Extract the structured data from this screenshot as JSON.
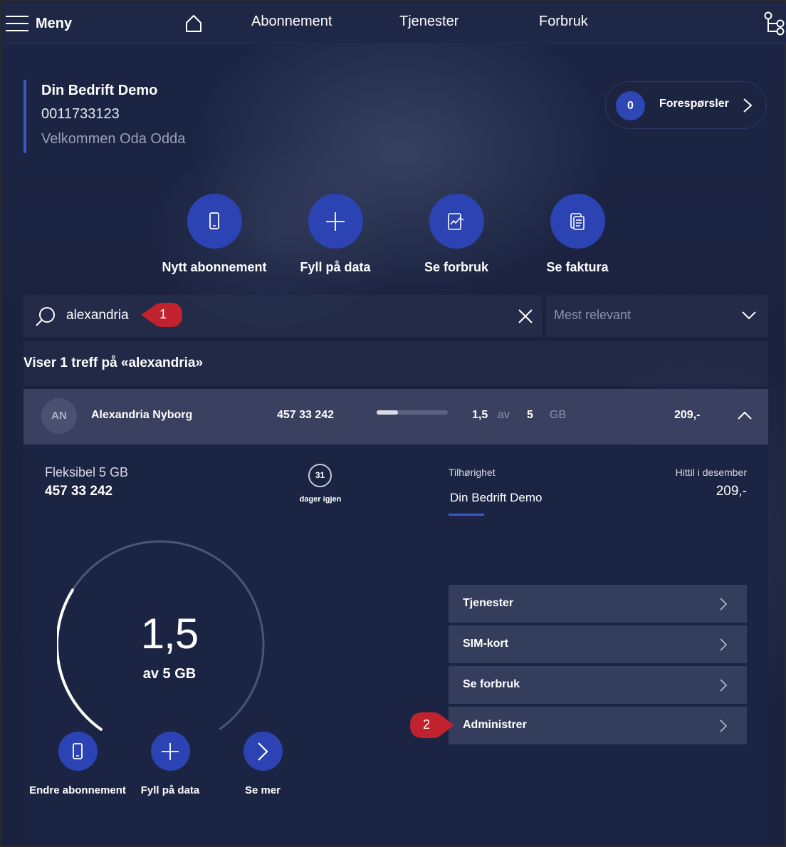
{
  "nav": {
    "menu_label": "Meny",
    "links": [
      "Abonnement",
      "Tjenester",
      "Forbruk"
    ]
  },
  "company": {
    "name": "Din Bedrift Demo",
    "number": "0011733123",
    "welcome": "Velkommen Oda Odda"
  },
  "requests": {
    "count": "0",
    "label": "Forespørsler"
  },
  "quick_actions": [
    {
      "label": "Nytt abonnement",
      "icon": "phone-icon"
    },
    {
      "label": "Fyll på data",
      "icon": "plus-icon"
    },
    {
      "label": "Se forbruk",
      "icon": "usage-chart-icon"
    },
    {
      "label": "Se faktura",
      "icon": "invoice-icon"
    }
  ],
  "search": {
    "value": "alexandria",
    "marker": "1"
  },
  "sort": {
    "selected": "Mest relevant"
  },
  "results": {
    "text": "Viser 1 treff på «alexandria»"
  },
  "subscription": {
    "initials": "AN",
    "name": "Alexandria Nyborg",
    "phone": "457 33 242",
    "used": "1,5",
    "of_label": "av",
    "total": "5",
    "unit": "GB",
    "usage_fraction": 0.3,
    "price": "209,-"
  },
  "detail": {
    "plan": "Fleksibel 5 GB",
    "phone": "457 33 242",
    "days": "31",
    "days_label": "dager igjen",
    "belonging_label": "Tilhørighet",
    "belonging_value": "Din Bedrift Demo",
    "so_far_label": "Hittil i desember",
    "so_far_value": "209,-",
    "gauge_value": "1,5",
    "gauge_unit": "av 5 GB",
    "gauge_fraction": 0.3,
    "actions": [
      {
        "label": "Endre abonnement",
        "icon": "phone-icon"
      },
      {
        "label": "Fyll på data",
        "icon": "plus-icon"
      },
      {
        "label": "Se mer",
        "icon": "chevron-right-icon"
      }
    ],
    "menu": [
      "Tjenester",
      "SIM-kort",
      "Se forbruk",
      "Administrer"
    ],
    "marker": "2"
  },
  "colors": {
    "accent": "#2c44b3",
    "marker": "#c0222e",
    "background": "#1a2240"
  }
}
